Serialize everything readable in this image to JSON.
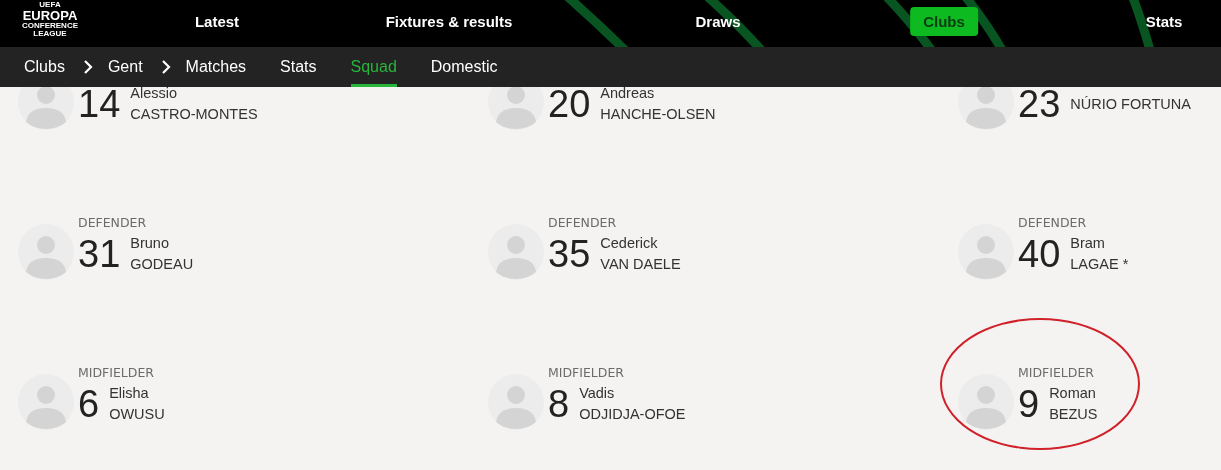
{
  "logo": {
    "lines": [
      "UEFA",
      "EUROPA",
      "CONFERENCE",
      "LEAGUE"
    ]
  },
  "main_nav": [
    {
      "label": "Latest",
      "selected": false
    },
    {
      "label": "Fixtures & results",
      "selected": false
    },
    {
      "label": "Draws",
      "selected": false
    },
    {
      "label": "Clubs",
      "selected": true
    },
    {
      "label": "Stats",
      "selected": false
    }
  ],
  "breadcrumb": [
    "Clubs",
    "Gent"
  ],
  "club_tabs": [
    {
      "label": "Matches",
      "selected": false
    },
    {
      "label": "Stats",
      "selected": false
    },
    {
      "label": "Squad",
      "selected": true
    },
    {
      "label": "Domestic",
      "selected": false
    }
  ],
  "players": [
    {
      "number": "14",
      "first_name": "Alessio",
      "last_name": "CASTRO-MONTES",
      "circled": false
    },
    {
      "number": "20",
      "first_name": "Andreas",
      "last_name": "HANCHE-OLSEN",
      "circled": false
    },
    {
      "number": "23",
      "last_name": "NÚRIO FORTUNA",
      "circled": false
    },
    {
      "position": "DEFENDER",
      "number": "31",
      "first_name": "Bruno",
      "last_name": "GODEAU",
      "circled": false
    },
    {
      "position": "DEFENDER",
      "number": "35",
      "first_name": "Cederick",
      "last_name": "VAN DAELE",
      "circled": false
    },
    {
      "position": "DEFENDER",
      "number": "40",
      "first_name": "Bram",
      "last_name": "LAGAE *",
      "circled": false
    },
    {
      "position": "MIDFIELDER",
      "number": "6",
      "first_name": "Elisha",
      "last_name": "OWUSU",
      "circled": false
    },
    {
      "position": "MIDFIELDER",
      "number": "8",
      "first_name": "Vadis",
      "last_name": "ODJIDJA-OFOE",
      "circled": false
    },
    {
      "position": "MIDFIELDER",
      "number": "9",
      "first_name": "Roman",
      "last_name": "BEZUS",
      "circled": true
    }
  ]
}
